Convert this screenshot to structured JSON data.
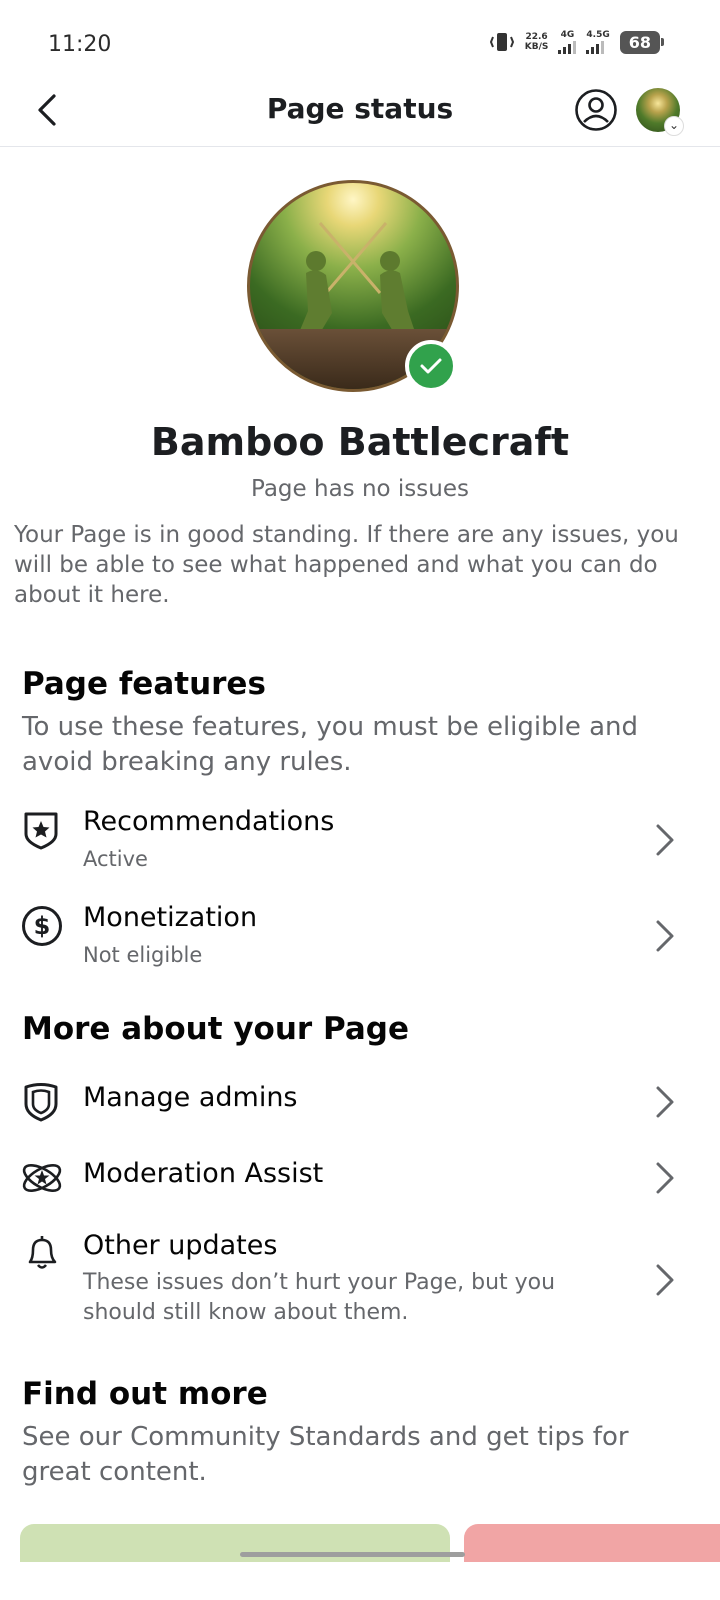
{
  "status_bar": {
    "time": "11:20",
    "speed_value": "22.6",
    "speed_unit": "KB/S",
    "net1": "4G",
    "net2": "4.5G",
    "battery": "68"
  },
  "header": {
    "title": "Page status"
  },
  "profile": {
    "name": "Bamboo Battlecraft",
    "status": "Page has no issues",
    "description": "Your Page is in good standing. If there are any issues, you will be able to see what happened and what you can do about it here."
  },
  "features": {
    "title": "Page features",
    "description": "To use these features, you must be eligible and avoid breaking any rules.",
    "items": [
      {
        "label": "Recommendations",
        "status": "Active",
        "icon": "shield-star-icon"
      },
      {
        "label": "Monetization",
        "status": "Not eligible",
        "icon": "dollar-circle-icon"
      }
    ]
  },
  "more": {
    "title": "More about your Page",
    "items": [
      {
        "label": "Manage admins",
        "icon": "shield-icon"
      },
      {
        "label": "Moderation Assist",
        "icon": "atom-star-icon"
      },
      {
        "label": "Other updates",
        "sub": "These issues don’t hurt your Page, but you should still know about them.",
        "icon": "bell-icon"
      }
    ]
  },
  "find_out": {
    "title": "Find out more",
    "description": "See our Community Standards and get tips for great content."
  },
  "colors": {
    "verified": "#31a24c",
    "secondary_text": "#65676b"
  }
}
